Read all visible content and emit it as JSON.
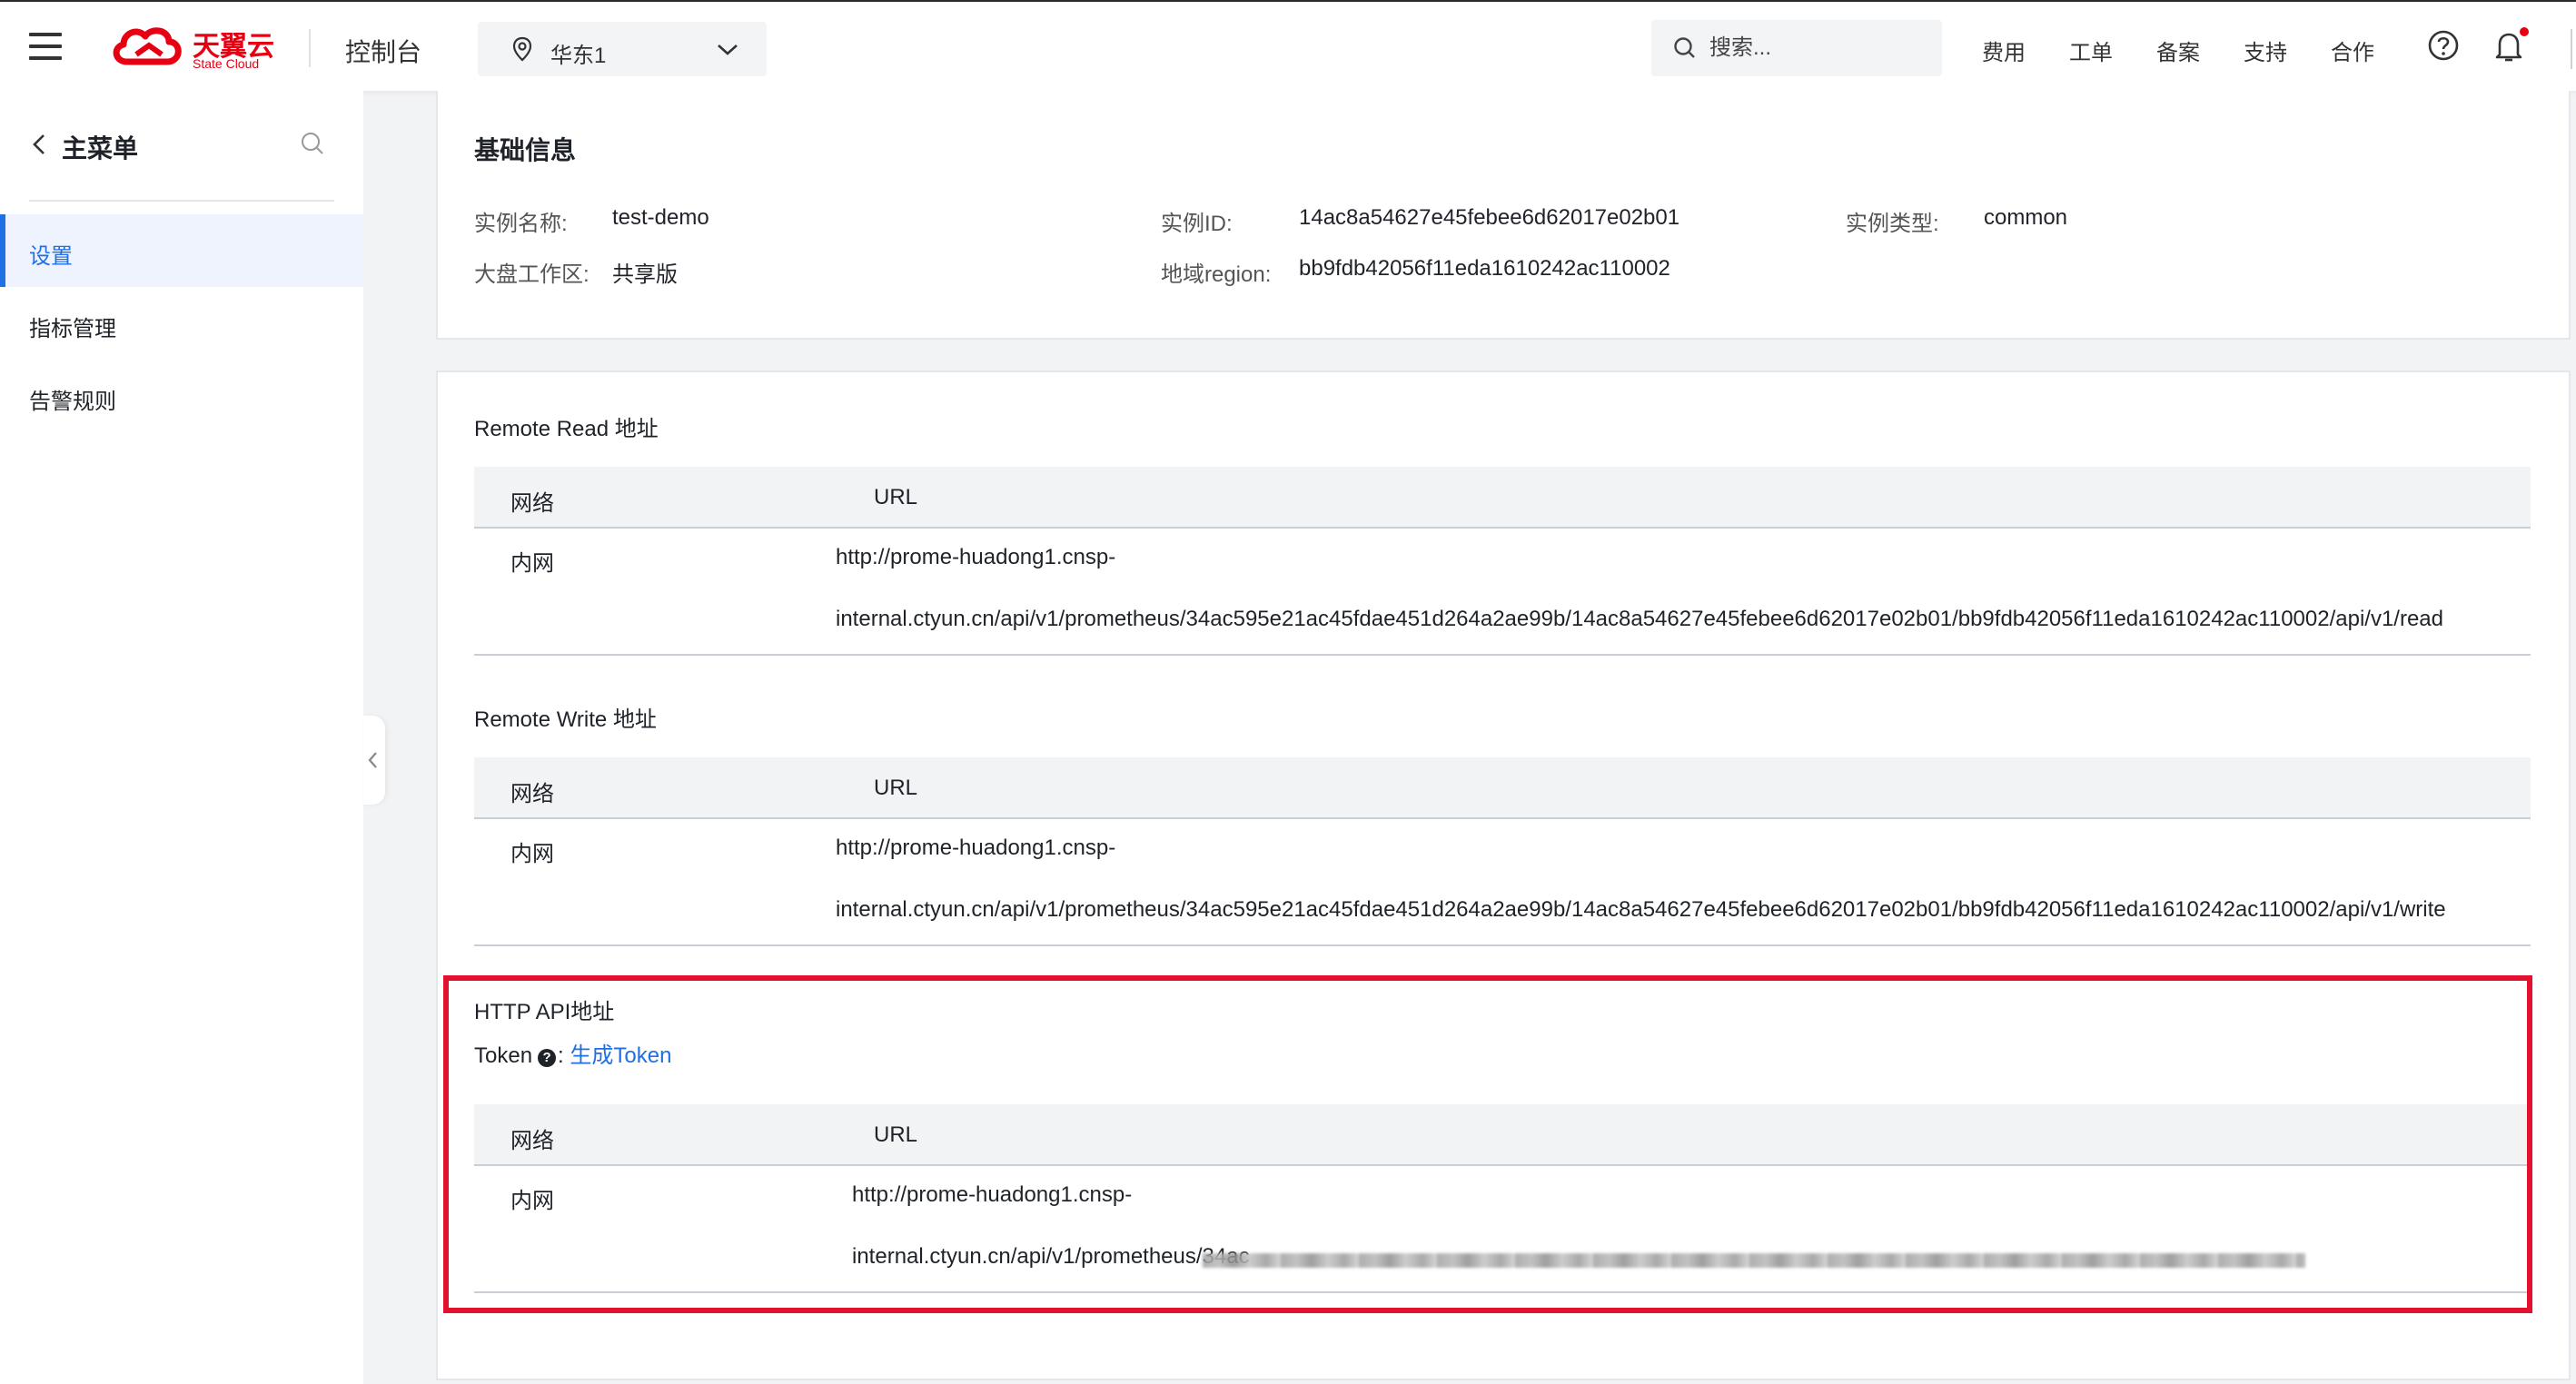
{
  "header": {
    "logo_text": "天翼云",
    "logo_sub": "State Cloud",
    "console_label": "控制台",
    "region_label": "华东1",
    "search_placeholder": "搜索...",
    "nav_links": [
      "费用",
      "工单",
      "备案",
      "支持",
      "合作"
    ]
  },
  "sidebar": {
    "title": "主菜单",
    "items": [
      {
        "label": "设置",
        "active": true
      },
      {
        "label": "指标管理",
        "active": false
      },
      {
        "label": "告警规则",
        "active": false
      }
    ]
  },
  "basic_info": {
    "title": "基础信息",
    "fields": [
      {
        "label": "实例名称:",
        "value": "test-demo"
      },
      {
        "label": "实例ID:",
        "value": "14ac8a54627e45febee6d62017e02b01"
      },
      {
        "label": "实例类型:",
        "value": "common"
      },
      {
        "label": "大盘工作区:",
        "value": "共享版"
      },
      {
        "label": "地域region:",
        "value": "bb9fdb42056f11eda1610242ac110002"
      }
    ]
  },
  "remote_read": {
    "title": "Remote Read 地址",
    "headers": [
      "网络",
      "URL"
    ],
    "network": "内网",
    "url_line1": "http://prome-huadong1.cnsp-",
    "url_line2": "internal.ctyun.cn/api/v1/prometheus/34ac595e21ac45fdae451d264a2ae99b/14ac8a54627e45febee6d62017e02b01/bb9fdb42056f11eda1610242ac110002/api/v1/read"
  },
  "remote_write": {
    "title": "Remote Write 地址",
    "headers": [
      "网络",
      "URL"
    ],
    "network": "内网",
    "url_line1": "http://prome-huadong1.cnsp-",
    "url_line2": "internal.ctyun.cn/api/v1/prometheus/34ac595e21ac45fdae451d264a2ae99b/14ac8a54627e45febee6d62017e02b01/bb9fdb42056f11eda1610242ac110002/api/v1/write"
  },
  "http_api": {
    "title": "HTTP API地址",
    "token_label": "Token",
    "token_sep": ":",
    "token_link": "生成Token",
    "headers": [
      "网络",
      "URL"
    ],
    "network": "内网",
    "url_line1": "http://prome-huadong1.cnsp-",
    "url_line2_visible": "internal.ctyun.cn/api/v1/prometheus/34ac"
  },
  "colors": {
    "brand_red": "#e60012",
    "link_blue": "#1f6fe5",
    "highlight_red": "#e3112d"
  }
}
